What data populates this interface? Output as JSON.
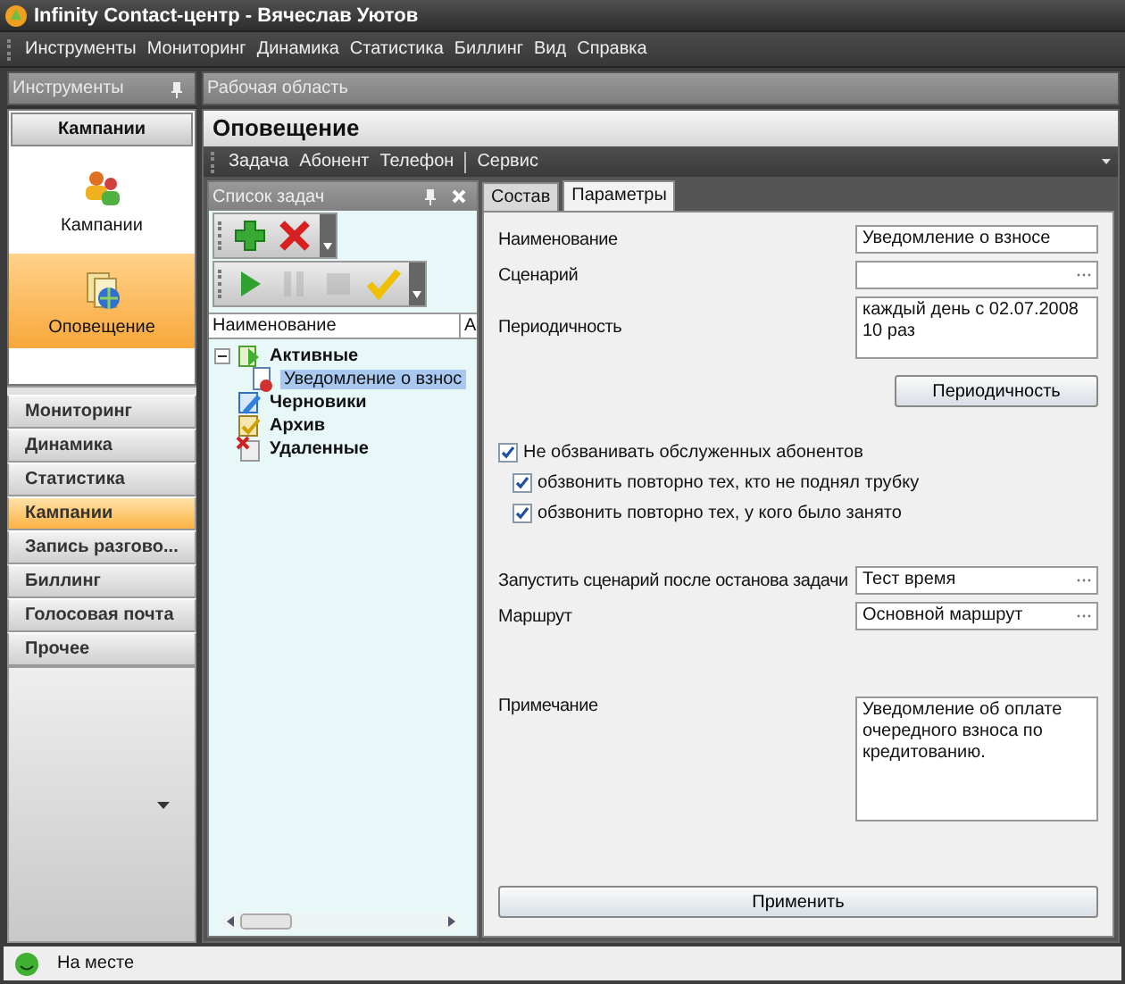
{
  "window": {
    "title": "Infinity Contact-центр - Вячеслав Уютов"
  },
  "menu": [
    "Инструменты",
    "Мониторинг",
    "Динамика",
    "Статистика",
    "Биллинг",
    "Вид",
    "Справка"
  ],
  "tools_panel": {
    "title": "Инструменты",
    "group": {
      "title": "Кампании",
      "items": [
        {
          "label": "Кампании",
          "kind": "people",
          "selected": false
        },
        {
          "label": "Оповещение",
          "kind": "notify",
          "selected": true
        }
      ]
    },
    "nav": [
      {
        "label": "Мониторинг",
        "selected": false
      },
      {
        "label": "Динамика",
        "selected": false
      },
      {
        "label": "Статистика",
        "selected": false
      },
      {
        "label": "Кампании",
        "selected": true
      },
      {
        "label": "Запись разгово...",
        "selected": false
      },
      {
        "label": "Биллинг",
        "selected": false
      },
      {
        "label": "Голосовая почта",
        "selected": false
      },
      {
        "label": "Прочее",
        "selected": false
      }
    ]
  },
  "workspace": {
    "title": "Рабочая область",
    "document": {
      "title": "Оповещение",
      "toolbar": [
        [
          "Задача",
          "Абонент",
          "Телефон"
        ],
        [
          "Сервис"
        ]
      ],
      "tasks": {
        "title": "Список задач",
        "toolbars": [
          [
            {
              "kind": "add",
              "disabled": false
            },
            {
              "kind": "delete",
              "disabled": false
            }
          ],
          [
            {
              "kind": "play",
              "disabled": false
            },
            {
              "kind": "pause",
              "disabled": true
            },
            {
              "kind": "stop",
              "disabled": true
            },
            {
              "kind": "check",
              "disabled": false
            }
          ]
        ],
        "columns": [
          "Наименование",
          "А"
        ],
        "tree": [
          {
            "label": "Активные",
            "kind": "active",
            "expanded": true,
            "selected": false,
            "children": [
              {
                "label": "Уведомление о взнос",
                "kind": "task",
                "selected": true
              }
            ]
          },
          {
            "label": "Черновики",
            "kind": "draft",
            "selected": false
          },
          {
            "label": "Архив",
            "kind": "archive",
            "selected": false
          },
          {
            "label": "Удаленные",
            "kind": "deleted",
            "selected": false
          }
        ]
      },
      "params": {
        "tabs": [
          {
            "label": "Состав",
            "selected": false
          },
          {
            "label": "Параметры",
            "selected": true
          }
        ],
        "name": {
          "label": "Наименование",
          "value": "Уведомление о взносе"
        },
        "scenario": {
          "label": "Сценарий"
        },
        "periodicity": {
          "label": "Периодичность",
          "value": "каждый день с 02.07.2008 10 раз",
          "button": "Периодичность"
        },
        "options": [
          {
            "label": "Не обзванивать обслуженных абонентов",
            "checked": true,
            "children": [
              {
                "label": "обзвонить повторно тех, кто не поднял трубку",
                "checked": true
              },
              {
                "label": "обзвонить повторно тех, у кого было занято",
                "checked": true
              }
            ]
          }
        ],
        "after_stop_scenario": {
          "label": "Запустить сценарий после останова задачи",
          "value": "Тест время"
        },
        "route": {
          "label": "Маршрут",
          "value": "Основной маршрут"
        },
        "note": {
          "label": "Примечание",
          "value": "Уведомление об оплате очередного взноса по кредитованию."
        },
        "apply_button": "Применить"
      }
    }
  },
  "status_bar": {
    "text": "На месте"
  }
}
